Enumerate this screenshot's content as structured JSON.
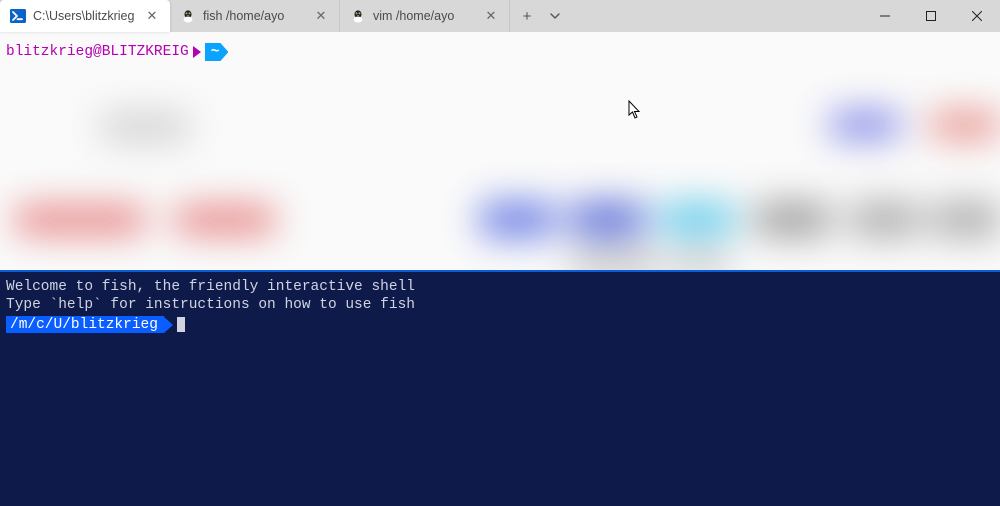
{
  "tabs": [
    {
      "title": "C:\\Users\\blitzkrieg",
      "icon": "ps"
    },
    {
      "title": "fish /home/ayo",
      "icon": "tux"
    },
    {
      "title": "vim /home/ayo",
      "icon": "tux"
    }
  ],
  "window_buttons": {
    "new_tab": "+",
    "dropdown": "⌄",
    "minimize": "—",
    "maximize": "▢",
    "close": "✕"
  },
  "upper": {
    "user_host": "blitzkrieg@BLITZKREIG",
    "path_badge": "~"
  },
  "lower": {
    "welcome_line": "Welcome to fish, the friendly interactive shell",
    "help_line": "Type `help` for instructions on how to use fish",
    "path_label": "/m/c/U/blitzkrieg"
  }
}
